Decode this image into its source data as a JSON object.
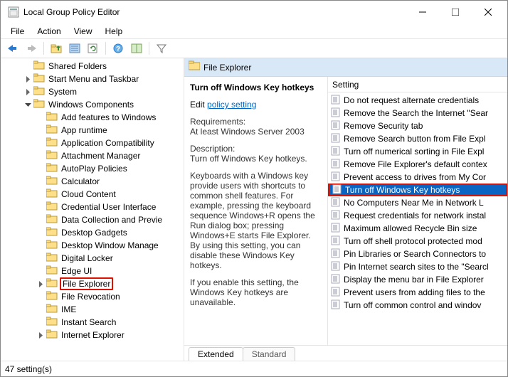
{
  "window": {
    "title": "Local Group Policy Editor"
  },
  "menu": [
    "File",
    "Action",
    "View",
    "Help"
  ],
  "tree": {
    "items": [
      {
        "label": "Shared Folders",
        "depth": 1,
        "twisty": ""
      },
      {
        "label": "Start Menu and Taskbar",
        "depth": 1,
        "twisty": ">"
      },
      {
        "label": "System",
        "depth": 1,
        "twisty": ">"
      },
      {
        "label": "Windows Components",
        "depth": 1,
        "twisty": "v"
      },
      {
        "label": "Add features to Windows",
        "depth": 2,
        "twisty": ""
      },
      {
        "label": "App runtime",
        "depth": 2,
        "twisty": ""
      },
      {
        "label": "Application Compatibility",
        "depth": 2,
        "twisty": ""
      },
      {
        "label": "Attachment Manager",
        "depth": 2,
        "twisty": ""
      },
      {
        "label": "AutoPlay Policies",
        "depth": 2,
        "twisty": ""
      },
      {
        "label": "Calculator",
        "depth": 2,
        "twisty": ""
      },
      {
        "label": "Cloud Content",
        "depth": 2,
        "twisty": ""
      },
      {
        "label": "Credential User Interface",
        "depth": 2,
        "twisty": ""
      },
      {
        "label": "Data Collection and Previe",
        "depth": 2,
        "twisty": ""
      },
      {
        "label": "Desktop Gadgets",
        "depth": 2,
        "twisty": ""
      },
      {
        "label": "Desktop Window Manage",
        "depth": 2,
        "twisty": ""
      },
      {
        "label": "Digital Locker",
        "depth": 2,
        "twisty": ""
      },
      {
        "label": "Edge UI",
        "depth": 2,
        "twisty": ""
      },
      {
        "label": "File Explorer",
        "depth": 2,
        "twisty": ">",
        "highlight": true
      },
      {
        "label": "File Revocation",
        "depth": 2,
        "twisty": ""
      },
      {
        "label": "IME",
        "depth": 2,
        "twisty": ""
      },
      {
        "label": "Instant Search",
        "depth": 2,
        "twisty": ""
      },
      {
        "label": "Internet Explorer",
        "depth": 2,
        "twisty": ">"
      }
    ]
  },
  "header": {
    "crumb": "File Explorer"
  },
  "desc": {
    "title": "Turn off Windows Key hotkeys",
    "edit_prefix": "Edit",
    "edit_link": "policy setting",
    "req_hd": "Requirements:",
    "req_body": "At least Windows Server 2003",
    "desc_hd": "Description:",
    "desc_body": "Turn off Windows Key hotkeys.",
    "para1": "Keyboards with a Windows key provide users with shortcuts to common shell features. For example, pressing the keyboard sequence Windows+R opens the Run dialog box; pressing Windows+E starts File Explorer. By using this setting, you can disable these Windows Key hotkeys.",
    "para2": "If you enable this setting, the Windows Key hotkeys are unavailable."
  },
  "list": {
    "col_header": "Setting",
    "items": [
      {
        "label": "Do not request alternate credentials"
      },
      {
        "label": "Remove the Search the Internet \"Sear"
      },
      {
        "label": "Remove Security tab"
      },
      {
        "label": "Remove Search button from File Expl"
      },
      {
        "label": "Turn off numerical sorting in File Expl"
      },
      {
        "label": "Remove File Explorer's default contex"
      },
      {
        "label": "Prevent access to drives from My Cor"
      },
      {
        "label": "Turn off Windows Key hotkeys",
        "selected": true,
        "highlight": true
      },
      {
        "label": "No Computers Near Me in Network L"
      },
      {
        "label": "Request credentials for network instal"
      },
      {
        "label": "Maximum allowed Recycle Bin size"
      },
      {
        "label": "Turn off shell protocol protected mod"
      },
      {
        "label": "Pin Libraries or Search Connectors to"
      },
      {
        "label": "Pin Internet search sites to the \"Searcl"
      },
      {
        "label": "Display the menu bar in File Explorer"
      },
      {
        "label": "Prevent users from adding files to the"
      },
      {
        "label": "Turn off common control and windov"
      }
    ]
  },
  "tabs": {
    "extended": "Extended",
    "standard": "Standard"
  },
  "status": "47 setting(s)"
}
